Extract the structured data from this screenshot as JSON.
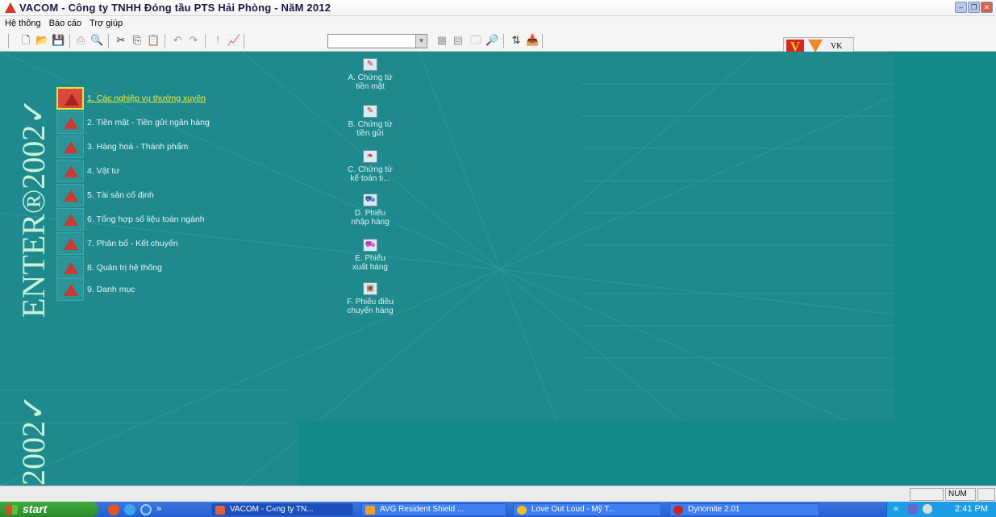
{
  "window": {
    "title": "VACOM - Công ty TNHH Đóng tầu PTS Hải Phòng - NăM 2012",
    "buttons": [
      "minimize-icon",
      "restore-icon",
      "close-icon"
    ]
  },
  "menu": {
    "items": [
      "Hệ thống",
      "Báo cáo",
      "Trợ giúp"
    ]
  },
  "toolbar": {
    "combo_value": "",
    "logo_text": "VK",
    "logo_letter": "V"
  },
  "branding": {
    "vertical_1": "ENTER®2002✓",
    "vertical_2": "2002✓"
  },
  "modules": [
    {
      "label": "1. Các nghiệp vụ thường xuyên",
      "active": true
    },
    {
      "label": "2. Tiền mặt - Tiền gửi ngân hàng",
      "active": false
    },
    {
      "label": "3. Hàng hoá - Thành phẩm",
      "active": false
    },
    {
      "label": "4. Vật tư",
      "active": false
    },
    {
      "label": "5. Tài sản cố định",
      "active": false
    },
    {
      "label": "6. Tổng hợp số liệu toàn ngành",
      "active": false
    },
    {
      "label": "7. Phân bổ - Kết chuyển",
      "active": false
    },
    {
      "label": "8. Quản trị hệ thống",
      "active": false
    },
    {
      "label": "9. Danh mục",
      "active": false
    }
  ],
  "documents": [
    {
      "line1": "A. Chứng từ",
      "line2": "tiền mặt",
      "icon": "cash-voucher-icon"
    },
    {
      "line1": "B. Chứng từ",
      "line2": "tiền gửi",
      "icon": "bank-voucher-icon"
    },
    {
      "line1": "C. Chứng từ",
      "line2": "kế toán ti...",
      "icon": "accounting-voucher-icon"
    },
    {
      "line1": "D. Phiếu",
      "line2": "nhập hàng",
      "icon": "goods-receipt-icon"
    },
    {
      "line1": "E. Phiếu",
      "line2": "xuất hàng",
      "icon": "goods-issue-icon"
    },
    {
      "line1": "F. Phiếu điều",
      "line2": "chuyển hàng",
      "icon": "goods-transfer-icon"
    }
  ],
  "statusbar": {
    "num": "NUM"
  },
  "taskbar": {
    "start": "start",
    "tasks": [
      {
        "label": "VACOM - C«ng ty TN...",
        "active": true
      },
      {
        "label": "AVG Resident Shield ...",
        "active": false
      },
      {
        "label": "Love Out Loud - Mỹ T...",
        "active": false
      },
      {
        "label": "Dynomite 2.01",
        "active": false
      }
    ],
    "clock": "2:41 PM"
  },
  "colors": {
    "workspace": "#1e8a8e",
    "active_label": "#f2ec3a",
    "taskbar": "#245ed2"
  }
}
